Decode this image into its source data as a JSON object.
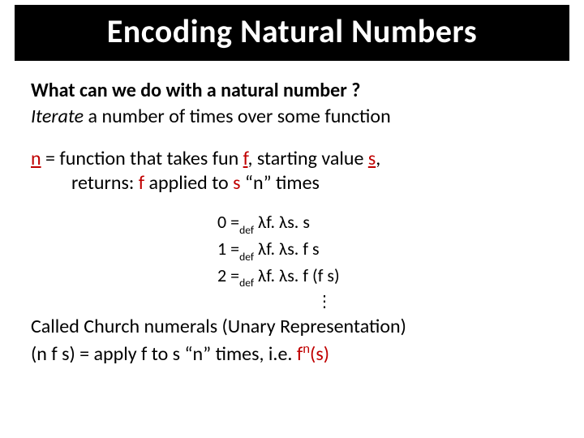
{
  "title": "Encoding Natural Numbers",
  "intro": {
    "question": "What can we do with a natural number ?",
    "answer_prefix_italic": "Iterate",
    "answer_rest": " a number of times over some function"
  },
  "def": {
    "n": "n",
    "part1_a": " =  function that takes fun ",
    "f1": "f",
    "part1_b": ", starting value ",
    "s1": "s",
    "part1_c": ",",
    "part2_a": "returns: ",
    "f2": "f",
    "part2_b": "  applied to ",
    "s2": "s",
    "part2_c": " “n” times"
  },
  "lambda_defs": {
    "d0": {
      "lhs": "0 =",
      "sub": "def",
      "rhs": " λf. λs. s"
    },
    "d1": {
      "lhs": "1 =",
      "sub": "def",
      "rhs": " λf. λs. f s"
    },
    "d2": {
      "lhs": "2 =",
      "sub": "def",
      "rhs": " λf. λs. f (f s)"
    }
  },
  "vdots": "⋮",
  "footer": {
    "line1": "Called Church numerals (Unary Representation)",
    "l2a": " (n f s) = apply f to s “n” times, i.e. ",
    "l2_fn_f": "f",
    "l2_fn_sup": "n",
    "l2_fn_tail": "(s)"
  }
}
